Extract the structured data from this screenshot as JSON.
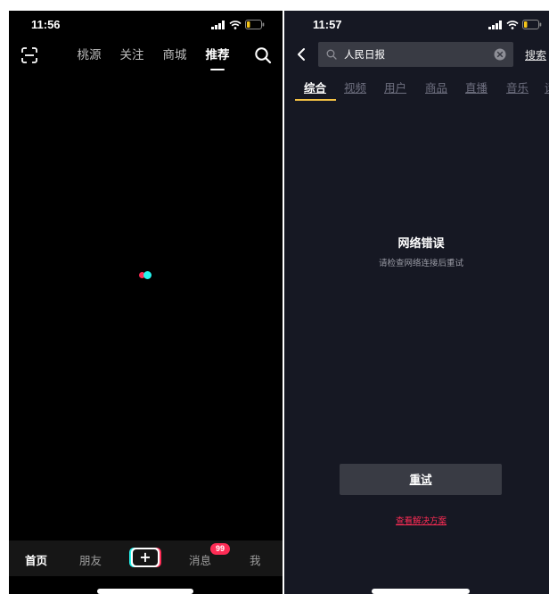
{
  "colors": {
    "left_background": "#000000",
    "right_background": "#161823",
    "brand_red": "#fe2c55",
    "brand_cyan": "#25f4ee",
    "tab_indicator": "#f5c244",
    "battery_low": "#f5c518"
  },
  "left_screen": {
    "status_bar": {
      "time": "11:56",
      "icons": [
        "signal-icon",
        "wifi-icon",
        "battery-icon"
      ]
    },
    "top_nav": {
      "scan_icon": "scan-icon",
      "tabs": [
        {
          "label": "桃源",
          "active": false
        },
        {
          "label": "关注",
          "active": false
        },
        {
          "label": "商城",
          "active": false
        },
        {
          "label": "推荐",
          "active": true
        }
      ],
      "search_icon": "search-icon"
    },
    "loading": {
      "icon": "loading-dots-icon"
    },
    "bottom_bar": {
      "items": [
        {
          "label": "首页",
          "active": true
        },
        {
          "label": "朋友",
          "active": false
        },
        {
          "label": "+",
          "active": false
        },
        {
          "label": "消息",
          "active": false
        },
        {
          "label": "我",
          "active": false
        }
      ],
      "message_badge": "99"
    }
  },
  "right_screen": {
    "status_bar": {
      "time": "11:57",
      "icons": [
        "signal-icon",
        "wifi-icon",
        "battery-icon"
      ]
    },
    "search": {
      "back_icon": "back-arrow-icon",
      "query": "人民日报",
      "clear_icon": "clear-icon",
      "button_label": "搜索"
    },
    "tabs": [
      {
        "label": "综合",
        "active": true
      },
      {
        "label": "视频",
        "active": false
      },
      {
        "label": "用户",
        "active": false
      },
      {
        "label": "商品",
        "active": false
      },
      {
        "label": "直播",
        "active": false
      },
      {
        "label": "音乐",
        "active": false
      },
      {
        "label": "话",
        "active": false
      }
    ],
    "error": {
      "title": "网络错误",
      "description": "请检查网络连接后重试",
      "retry_label": "重试",
      "solution_link": "查看解决方案"
    }
  }
}
